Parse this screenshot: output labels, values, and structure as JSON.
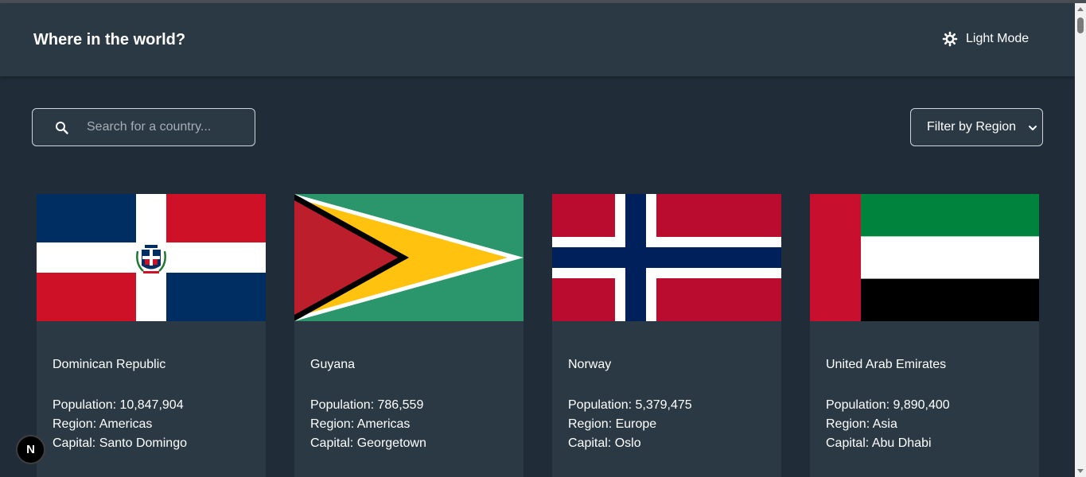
{
  "header": {
    "title": "Where in the world?",
    "mode_label": "Light Mode",
    "mode_icon": "sun-icon"
  },
  "search": {
    "placeholder": "Search for a country...",
    "value": "",
    "icon": "search-icon"
  },
  "filter": {
    "selected": "Filter by Region"
  },
  "countries": [
    {
      "name": "Dominican Republic",
      "population": "Population: 10,847,904",
      "region": "Region: Americas",
      "capital": "Capital: Santo Domingo",
      "flag": "dominican-republic-flag"
    },
    {
      "name": "Guyana",
      "population": "Population: 786,559",
      "region": "Region: Americas",
      "capital": "Capital: Georgetown",
      "flag": "guyana-flag"
    },
    {
      "name": "Norway",
      "population": "Population: 5,379,475",
      "region": "Region: Europe",
      "capital": "Capital: Oslo",
      "flag": "norway-flag"
    },
    {
      "name": "United Arab Emirates",
      "population": "Population: 9,890,400",
      "region": "Region: Asia",
      "capital": "Capital: Abu Dhabi",
      "flag": "uae-flag"
    }
  ],
  "devtools_badge": {
    "label": "N"
  },
  "colors": {
    "background": "#202c37",
    "element": "#2b3945",
    "text": "#ffffff"
  }
}
